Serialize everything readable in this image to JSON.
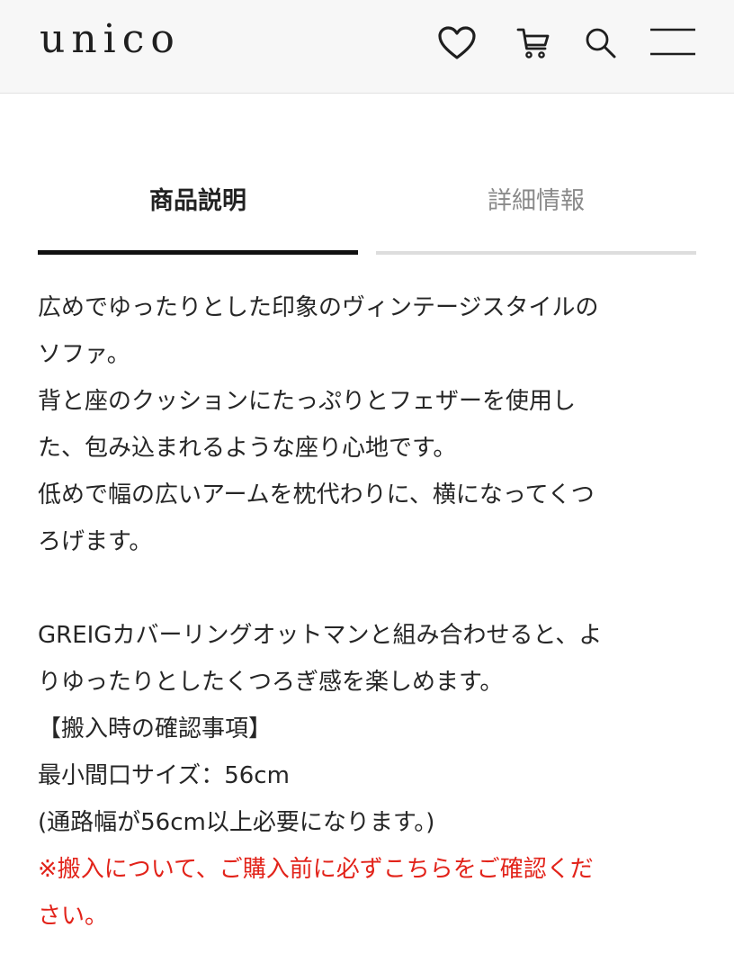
{
  "header": {
    "logo": "unico",
    "icons": [
      "heart-icon",
      "cart-icon",
      "search-icon",
      "menu-icon"
    ]
  },
  "tabs": [
    {
      "label": "商品説明",
      "active": true
    },
    {
      "label": "詳細情報",
      "active": false
    }
  ],
  "description": {
    "line1": "広めでゆったりとした印象のヴィンテージスタイルの",
    "line2": "ソファ。",
    "line3": "背と座のクッションにたっぷりとフェザーを使用し",
    "line4": "た、包み込まれるような座り心地です。",
    "line5": "低めで幅の広いアームを枕代わりに、横になってくつ",
    "line6": "ろげます。",
    "line7": "GREIGカバーリングオットマンと組み合わせると、よ",
    "line8": "りゆったりとしたくつろぎ感を楽しめます。",
    "check_heading": "【搬入時の確認事項】",
    "min_opening": "最小間口サイズ：56cm",
    "passage_note": "(通路幅が56cm以上必要になります。)",
    "notice_line1": "※搬入について、ご購入前に必ずこちらをご確認くだ",
    "notice_line2": "さい。"
  },
  "colors": {
    "text": "#262626",
    "notice": "#e2231a",
    "header_bg": "#f7f7f7",
    "tab_active": "#111111",
    "tab_inactive": "#dddddd"
  }
}
